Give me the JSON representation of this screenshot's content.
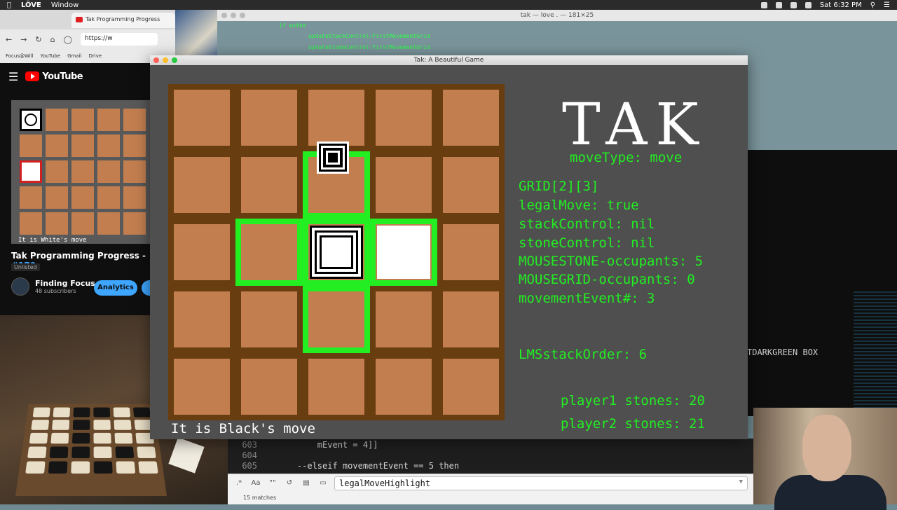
{
  "menubar": {
    "app": "LÖVE",
    "menu_window": "Window",
    "clock": "Sat 6:32 PM"
  },
  "terminal": {
    "title": "tak — love . — 181×25",
    "lines": [
      "if anthe",
      "updateStackControl:FirstMovementGrid",
      "updateStoneControl:FirstMovementGrid"
    ]
  },
  "browser": {
    "tab_title": "Tak Programming Progress",
    "url": "https://w",
    "bookmarks": [
      "Focus@Will",
      "YouTube",
      "Gmail",
      "Drive"
    ]
  },
  "youtube": {
    "brand": "YouTube",
    "thumb_caption": "It is White's move",
    "video_title": "Tak Programming Progress - ",
    "video_tag": "#170",
    "visibility": "Unlisted",
    "channel_name": "Finding Focus",
    "subscribers": "48 subscribers",
    "analytics_label": "Analytics"
  },
  "editor": {
    "lines": [
      {
        "num": "603",
        "code": "        mEvent = 4]]"
      },
      {
        "num": "604",
        "code": ""
      },
      {
        "num": "605",
        "code": "    --elseif movementEvent == 5 then"
      }
    ],
    "find_query": "legalMoveHighlight",
    "match_count": "15 matches",
    "find_options": [
      ".*",
      "Aa",
      "\"\""
    ]
  },
  "darkpanel": {
    "text": "TDARKGREEN BOX"
  },
  "tak": {
    "window_title": "Tak: A Beautiful Game",
    "logo": "TAK",
    "move_type": "moveType: move",
    "debug_lines": [
      "GRID[2][3]",
      "legalMove: true",
      "stackControl: nil",
      "stoneControl: nil",
      "MOUSESTONE-occupants: 5",
      "MOUSEGRID-occupants: 0",
      "movementEvent#: 3"
    ],
    "lms_stack_order": "LMSstackOrder: 6",
    "player1_stones": "player1 stones: 20",
    "player2_stones": "player2 stones: 21",
    "status": "It is Black's move",
    "colors": {
      "board_bg": "#683d0f",
      "cell": "#c37e50",
      "highlight": "#22ee22",
      "debug_text": "#22ee22",
      "window_bg": "#4f4f4f"
    }
  }
}
